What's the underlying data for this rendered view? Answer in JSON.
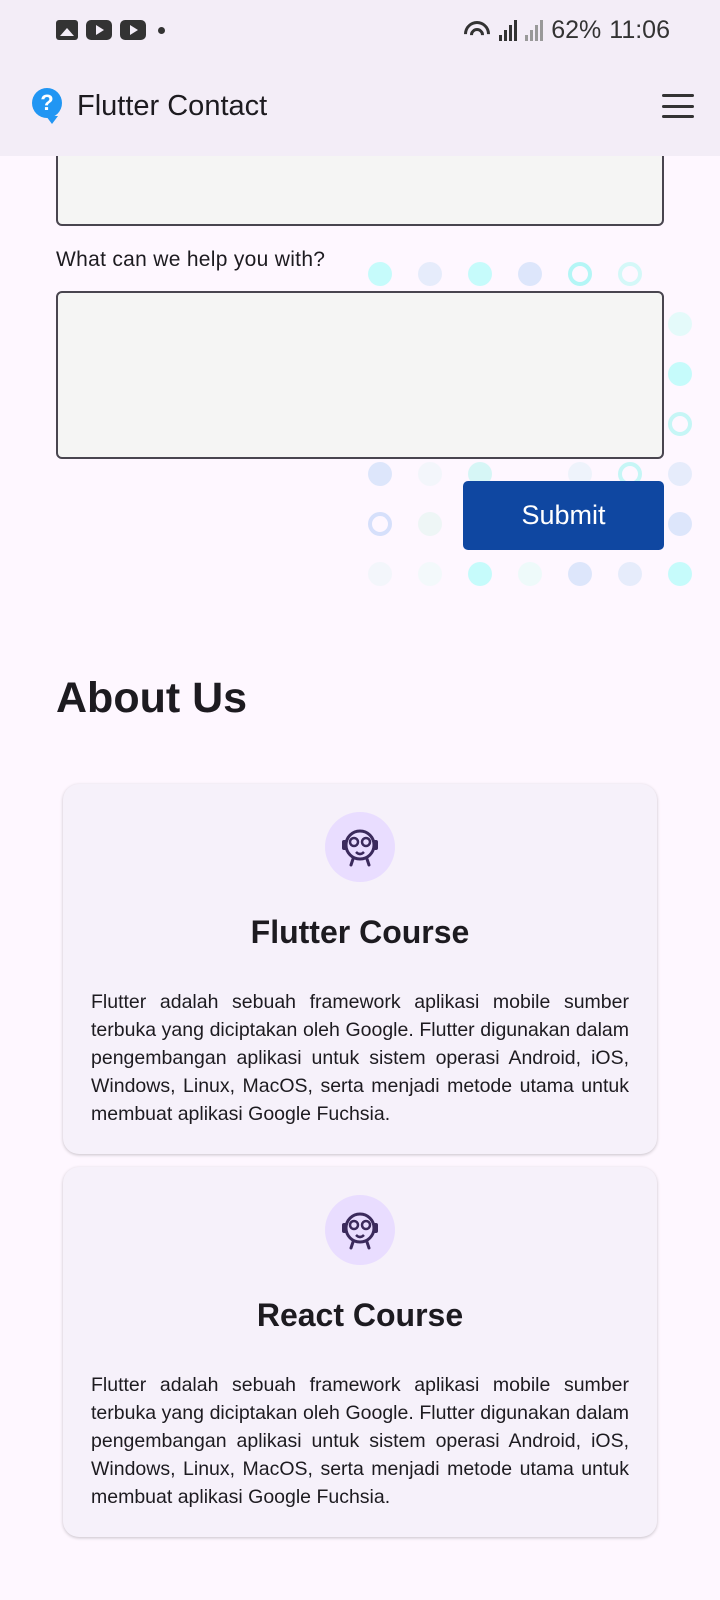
{
  "status_bar": {
    "icons": [
      "image-icon",
      "youtube-icon",
      "youtube-icon",
      "dot-icon"
    ],
    "battery": "62%",
    "time": "11:06"
  },
  "app_bar": {
    "title": "Flutter Contact",
    "logo_icon": "help-icon",
    "menu_icon": "menu-icon"
  },
  "form": {
    "help_label": "What can we help you with?",
    "previous_field_value": "",
    "help_value": "",
    "submit_label": "Submit"
  },
  "about": {
    "title": "About Us",
    "cards": [
      {
        "icon": "mascot-icon",
        "title": "Flutter Course",
        "description": "Flutter adalah sebuah framework aplikasi mobile sumber terbuka yang diciptakan oleh Google. Flutter digunakan dalam pengembangan aplikasi untuk sistem operasi Android, iOS, Windows, Linux, MacOS, serta menjadi metode utama untuk membuat aplikasi Google Fuchsia."
      },
      {
        "icon": "mascot-icon",
        "title": "React Course",
        "description": "Flutter adalah sebuah framework aplikasi mobile sumber terbuka yang diciptakan oleh Google. Flutter digunakan dalam pengembangan aplikasi untuk sistem operasi Android, iOS, Windows, Linux, MacOS, serta menjadi metode utama untuk membuat aplikasi Google Fuchsia."
      }
    ]
  },
  "colors": {
    "primary_button": "#0f47a1",
    "app_bar": "#f3edf7",
    "background": "#fef7ff",
    "card": "#f6f1fa",
    "avatar": "#e9ddff"
  }
}
